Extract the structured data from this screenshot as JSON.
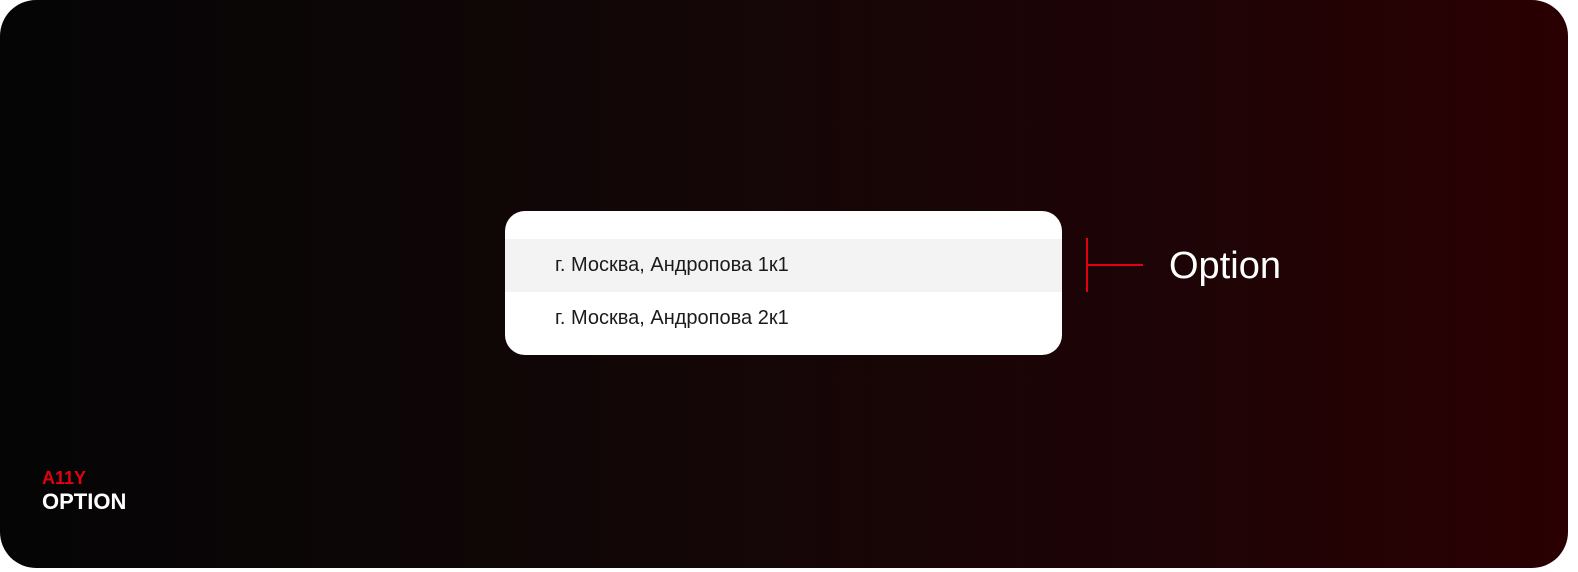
{
  "listbox": {
    "options": [
      {
        "label": "г. Москва, Андропова 1к1",
        "state": "hovered"
      },
      {
        "label": "г. Москва, Андропова 2к1",
        "state": "default"
      }
    ]
  },
  "annotation": {
    "label": "Option",
    "color": "#e3000f"
  },
  "footer": {
    "category": "A11Y",
    "title": "OPTION"
  }
}
